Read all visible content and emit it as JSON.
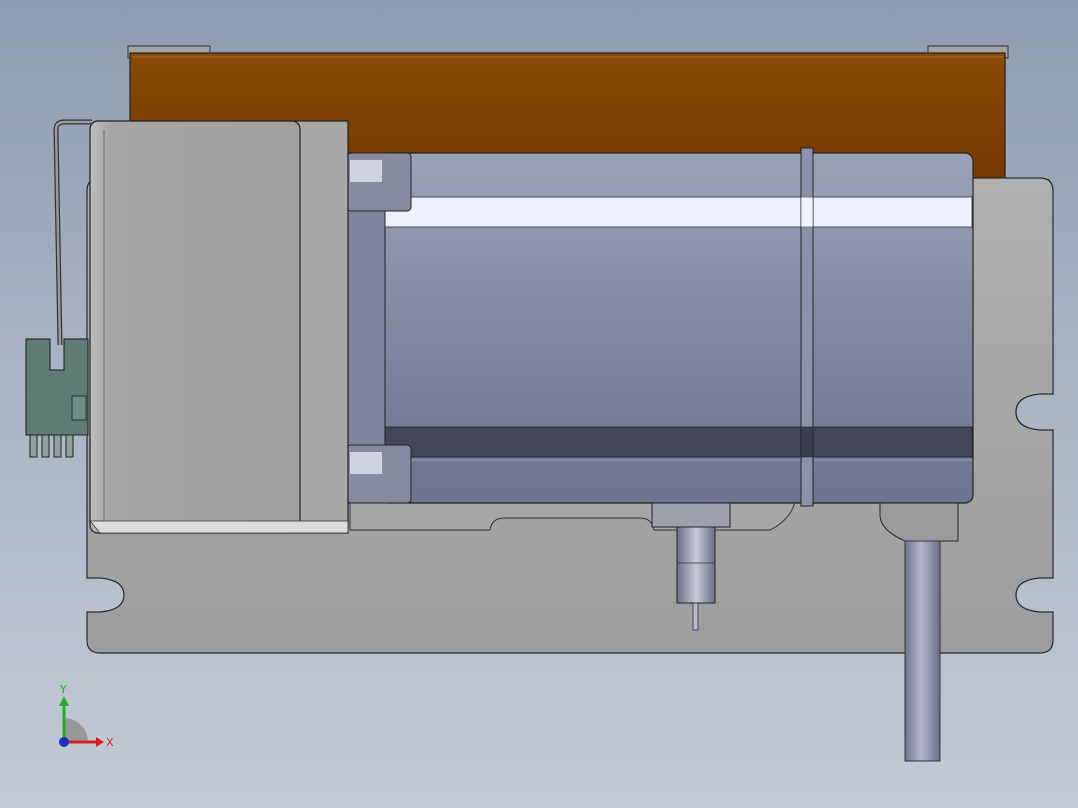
{
  "viewport": {
    "background_top": "#8e9bb0",
    "background_bottom": "#c4cbd6"
  },
  "model": {
    "components": [
      {
        "name": "mounting-plate",
        "color": "#a6a6a6"
      },
      {
        "name": "heatsink-cover",
        "color": "#7a3c00"
      },
      {
        "name": "motor-body",
        "color": "#8890a6"
      },
      {
        "name": "encoder-housing",
        "color": "#a3a3a3"
      },
      {
        "name": "connector-block",
        "color": "#5e7b74"
      },
      {
        "name": "cable",
        "color": "#8e92ad"
      }
    ]
  },
  "triad": {
    "x_label": "X",
    "y_label": "Y",
    "x_color": "#d42020",
    "y_color": "#20b020",
    "z_color": "#2030c0"
  }
}
